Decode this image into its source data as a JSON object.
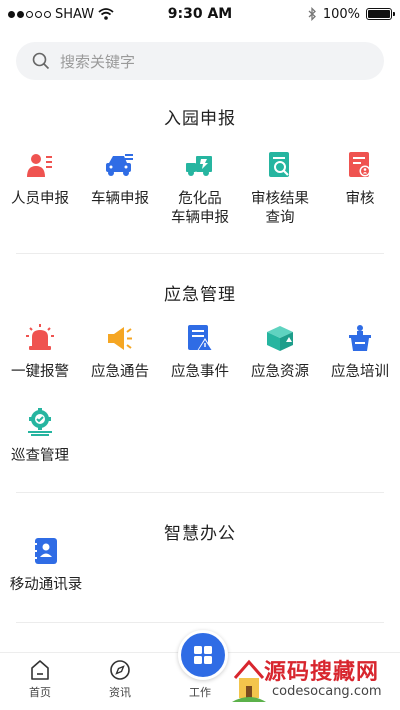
{
  "status_bar": {
    "carrier": "SHAW",
    "time": "9:30 AM",
    "battery": "100%"
  },
  "search": {
    "placeholder": "搜索关键字"
  },
  "sections": [
    {
      "title": "入园申报",
      "items": [
        {
          "label": "人员申报",
          "icon": "person-report-icon"
        },
        {
          "label": "车辆申报",
          "icon": "car-report-icon"
        },
        {
          "label": "危化品\n车辆申报",
          "icon": "hazmat-truck-icon"
        },
        {
          "label": "审核结果\n查询",
          "icon": "audit-query-icon"
        },
        {
          "label": "审核",
          "icon": "audit-icon"
        }
      ]
    },
    {
      "title": "应急管理",
      "items": [
        {
          "label": "一键报警",
          "icon": "alarm-light-icon"
        },
        {
          "label": "应急通告",
          "icon": "megaphone-icon"
        },
        {
          "label": "应急事件",
          "icon": "event-warning-icon"
        },
        {
          "label": "应急资源",
          "icon": "resource-box-icon"
        },
        {
          "label": "应急培训",
          "icon": "training-podium-icon"
        },
        {
          "label": "巡查管理",
          "icon": "patrol-gear-icon"
        }
      ]
    },
    {
      "title": "智慧办公",
      "items": [
        {
          "label": "移动通讯录",
          "icon": "contacts-book-icon"
        }
      ]
    }
  ],
  "tabbar": {
    "tabs": [
      {
        "label": "首页",
        "icon": "home-icon"
      },
      {
        "label": "资讯",
        "icon": "compass-icon"
      },
      {
        "label": "工作",
        "icon": "work-icon"
      }
    ]
  },
  "watermark": {
    "title": "源码搜藏网",
    "url": "codesocang.com"
  },
  "colors": {
    "red": "#ef5350",
    "blue": "#2f6ce5",
    "teal": "#26b5a0",
    "orange": "#f5a623"
  }
}
